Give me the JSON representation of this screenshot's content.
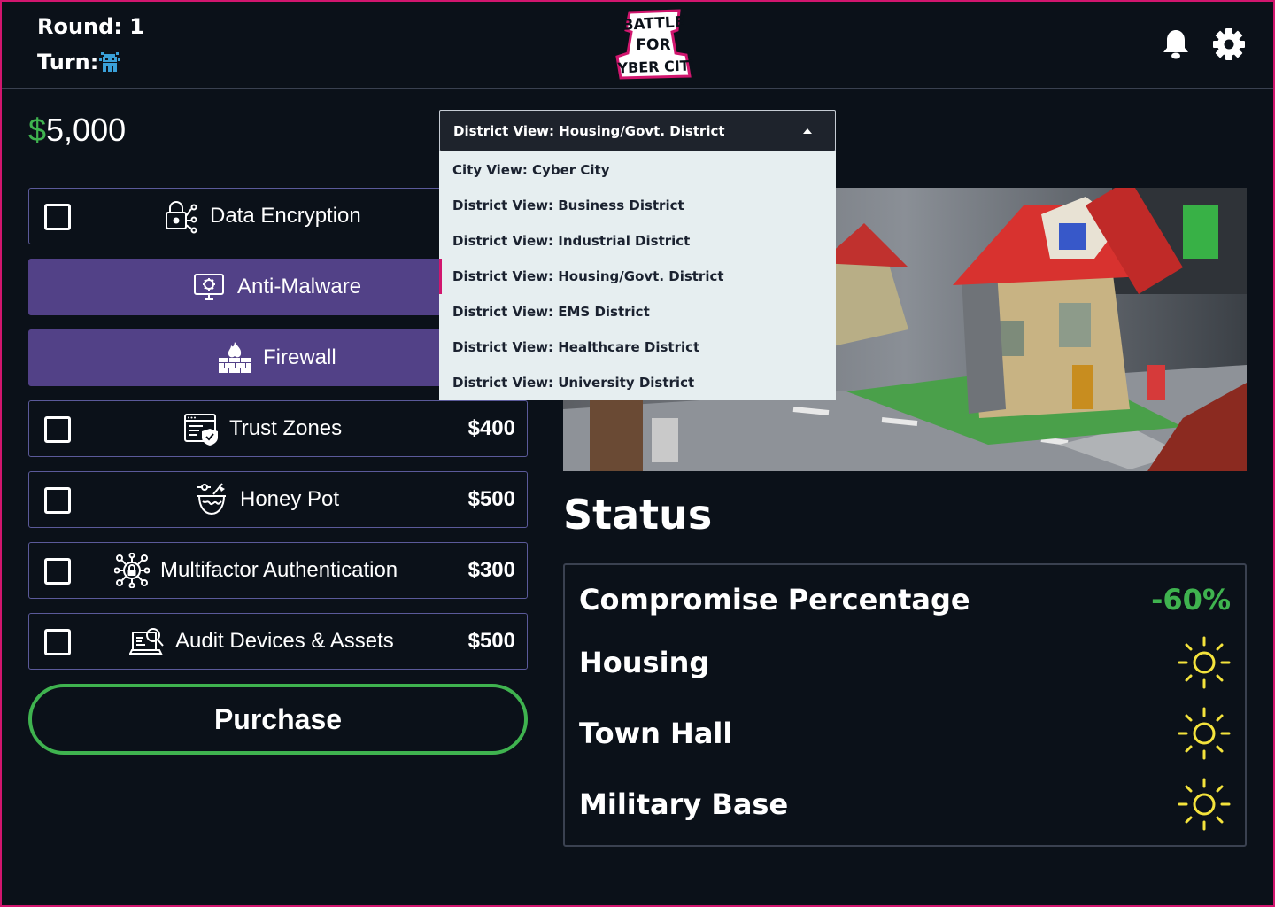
{
  "header": {
    "round_label": "Round:  1",
    "turn_label": "Turn:",
    "turn_icon": "pixel-robot-icon",
    "logo_lines": [
      "BATTLE",
      "FOR",
      "CYBER CITY"
    ],
    "notification_icon": "bell-icon",
    "settings_icon": "gear-icon"
  },
  "money": {
    "symbol": "$",
    "amount": "5,000"
  },
  "items": [
    {
      "label": "Data Encryption",
      "price": "",
      "icon": "lock-network-icon",
      "selected": false
    },
    {
      "label": "Anti-Malware",
      "price": "",
      "icon": "monitor-virus-icon",
      "selected": true
    },
    {
      "label": "Firewall",
      "price": "",
      "icon": "brick-wall-fire-icon",
      "selected": true
    },
    {
      "label": "Trust Zones",
      "price": "$400",
      "icon": "window-shield-icon",
      "selected": false
    },
    {
      "label": "Honey Pot",
      "price": "$500",
      "icon": "honey-pot-icon",
      "selected": false
    },
    {
      "label": "Multifactor Authentication",
      "price": "$300",
      "icon": "network-lock-icon",
      "selected": false
    },
    {
      "label": "Audit Devices & Assets",
      "price": "$500",
      "icon": "laptop-search-icon",
      "selected": false
    }
  ],
  "purchase_label": "Purchase",
  "dropdown": {
    "selected": "District View: Housing/Govt.  District",
    "options": [
      "City View: Cyber City",
      "District View: Business District",
      "District View: Industrial District",
      "District View: Housing/Govt.  District",
      "District View: EMS  District",
      "District View: Healthcare  District",
      "District View: University  District"
    ]
  },
  "status": {
    "title": "Status",
    "compromise_label": "Compromise Percentage",
    "compromise_value": "-60%",
    "rows": [
      {
        "label": "Housing",
        "icon": "sun-icon"
      },
      {
        "label": "Town Hall",
        "icon": "sun-icon"
      },
      {
        "label": "Military Base",
        "icon": "sun-icon"
      }
    ]
  },
  "colors": {
    "accent_green": "#3fb34f",
    "selected_purple": "#524187",
    "frame_pink": "#d1166e",
    "sun_yellow": "#f4e33c"
  }
}
